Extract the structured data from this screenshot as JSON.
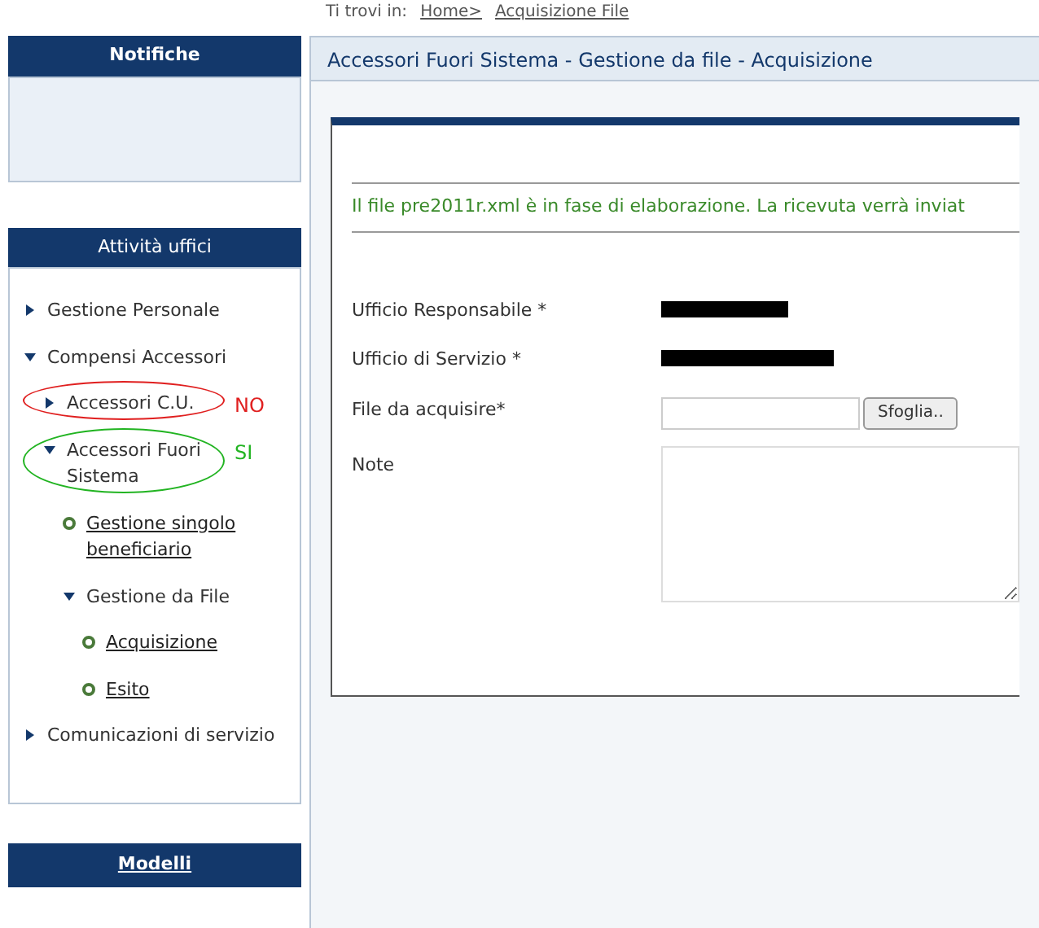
{
  "breadcrumb": {
    "label": "Ti trovi in:",
    "links": [
      "Home>",
      "Acquisizione File"
    ]
  },
  "sidebar": {
    "notifications": {
      "title": "Notifiche"
    },
    "activities": {
      "title": "Attività uffici",
      "items": [
        {
          "label": "Gestione Personale",
          "expanded": false
        },
        {
          "label": "Compensi Accessori",
          "expanded": true,
          "children": [
            {
              "label": "Accessori C.U.",
              "expanded": false,
              "annotation": {
                "text": "NO",
                "color": "#e02020"
              }
            },
            {
              "label": "Accessori Fuori Sistema",
              "expanded": true,
              "annotation": {
                "text": "SI",
                "color": "#22b422"
              },
              "children": [
                {
                  "label": "Gestione singolo beneficiario",
                  "kind": "leaf"
                },
                {
                  "label": "Gestione da File",
                  "expanded": true,
                  "children": [
                    {
                      "label": "Acquisizione",
                      "kind": "leaf"
                    },
                    {
                      "label": "Esito",
                      "kind": "leaf"
                    }
                  ]
                }
              ]
            }
          ]
        },
        {
          "label": "Comunicazioni di servizio",
          "expanded": false
        }
      ]
    },
    "models": {
      "title": "Modelli"
    }
  },
  "main": {
    "title": "Accessori Fuori Sistema - Gestione da file - Acquisizione",
    "message": "Il file pre2011r.xml è in fase di elaborazione. La ricevuta verrà inviat",
    "fields": [
      {
        "label": "Ufficio Responsabile *",
        "kind": "redacted"
      },
      {
        "label": "Ufficio di Servizio *",
        "kind": "redacted"
      },
      {
        "label": "File da acquisire*",
        "kind": "file",
        "button": "Sfoglia.."
      },
      {
        "label": "Note",
        "kind": "textarea"
      }
    ]
  }
}
